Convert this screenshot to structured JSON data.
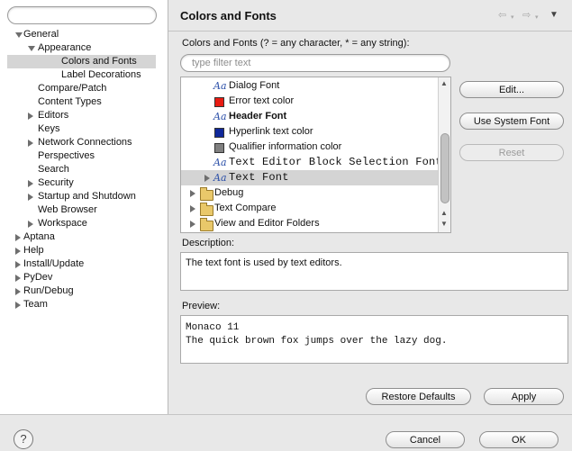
{
  "left_tree": {
    "filter_placeholder": "",
    "items": [
      {
        "label": "General",
        "level": 0,
        "toggle": "down"
      },
      {
        "label": "Appearance",
        "level": 1,
        "toggle": "down"
      },
      {
        "label": "Colors and Fonts",
        "level": 2,
        "toggle": "",
        "selected": true
      },
      {
        "label": "Label Decorations",
        "level": 2,
        "toggle": ""
      },
      {
        "label": "Compare/Patch",
        "level": 1,
        "toggle": ""
      },
      {
        "label": "Content Types",
        "level": 1,
        "toggle": ""
      },
      {
        "label": "Editors",
        "level": 1,
        "toggle": "right"
      },
      {
        "label": "Keys",
        "level": 1,
        "toggle": ""
      },
      {
        "label": "Network Connections",
        "level": 1,
        "toggle": "right"
      },
      {
        "label": "Perspectives",
        "level": 1,
        "toggle": ""
      },
      {
        "label": "Search",
        "level": 1,
        "toggle": ""
      },
      {
        "label": "Security",
        "level": 1,
        "toggle": "right"
      },
      {
        "label": "Startup and Shutdown",
        "level": 1,
        "toggle": "right"
      },
      {
        "label": "Web Browser",
        "level": 1,
        "toggle": ""
      },
      {
        "label": "Workspace",
        "level": 1,
        "toggle": "right"
      },
      {
        "label": "Aptana",
        "level": 0,
        "toggle": "right"
      },
      {
        "label": "Help",
        "level": 0,
        "toggle": "right"
      },
      {
        "label": "Install/Update",
        "level": 0,
        "toggle": "right"
      },
      {
        "label": "PyDev",
        "level": 0,
        "toggle": "right"
      },
      {
        "label": "Run/Debug",
        "level": 0,
        "toggle": "right"
      },
      {
        "label": "Team",
        "level": 0,
        "toggle": "right"
      }
    ]
  },
  "header": {
    "title": "Colors and Fonts",
    "nav_icons": [
      "back-arrow-icon",
      "forward-arrow-icon",
      "menu-dropdown-icon"
    ]
  },
  "colors_fonts": {
    "label": "Colors and Fonts (? = any character, * = any string):",
    "filter_placeholder": "type filter text",
    "rows": [
      {
        "label": "Dialog Font",
        "icon": "font-icon",
        "style": "normal"
      },
      {
        "label": "Error text color",
        "icon": "color-swatch",
        "color": "#e81b12"
      },
      {
        "label": "Header Font",
        "icon": "font-icon",
        "style": "bold"
      },
      {
        "label": "Hyperlink text color",
        "icon": "color-swatch",
        "color": "#10289a"
      },
      {
        "label": "Qualifier information color",
        "icon": "color-swatch",
        "color": "#808080"
      },
      {
        "label": "Text Editor Block Selection Font",
        "icon": "font-icon",
        "style": "mono"
      },
      {
        "label": "Text Font",
        "icon": "font-icon",
        "style": "mono",
        "selected": true,
        "toggle": "right"
      },
      {
        "label": "Debug",
        "icon": "folder-icon",
        "toggle": "right"
      },
      {
        "label": "Text Compare",
        "icon": "folder-icon",
        "toggle": "right"
      },
      {
        "label": "View and Editor Folders",
        "icon": "folder-icon",
        "toggle": "right"
      }
    ],
    "font_icon_glyph": "Aa"
  },
  "buttons": {
    "edit": "Edit...",
    "use_system_font": "Use System Font",
    "reset": "Reset",
    "restore_defaults": "Restore Defaults",
    "apply": "Apply",
    "cancel": "Cancel",
    "ok": "OK"
  },
  "description": {
    "label": "Description:",
    "text": "The text font is used by text editors."
  },
  "preview": {
    "label": "Preview:",
    "line1": "Monaco 11",
    "line2": "The quick brown fox jumps over the lazy dog."
  },
  "help": {
    "glyph": "?"
  },
  "colors": {
    "selection_bg": "#d4d4d4",
    "font_icon": "#2b4fa8"
  }
}
